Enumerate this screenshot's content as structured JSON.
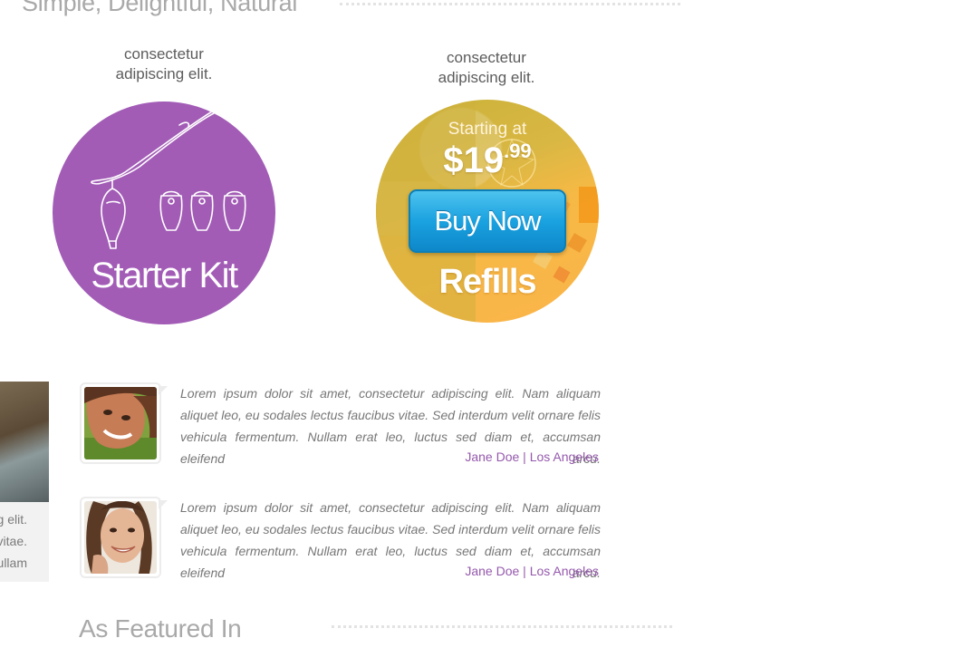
{
  "sections": {
    "top_title": "Simple, Delightful, Natural",
    "featured_title": "As Featured In"
  },
  "products": {
    "starter": {
      "caption_line1": "consectetur",
      "caption_line2": "adipiscing elit.",
      "label": "Starter Kit",
      "color": "#a25cb6"
    },
    "refills": {
      "caption_line1": "consectetur",
      "caption_line2": "adipiscing elit.",
      "starting_text": "Starting at",
      "price_main": "$19",
      "price_cents": ".99",
      "button_label": "Buy Now",
      "label": "Refills",
      "color": "#f6b945"
    }
  },
  "left_card": {
    "lines": [
      "g elit.",
      "vitae.",
      "ullam"
    ]
  },
  "testimonials": [
    {
      "text": "Lorem ipsum dolor sit amet, consectetur adipiscing elit. Nam aliquam aliquet leo, eu sodales lectus faucibus vitae. Sed interdum velit ornare felis vehicula fermentum. Nullam erat leo, luctus sed diam et, accumsan eleifend arcu.",
      "author": "Jane Doe | Los Angeles"
    },
    {
      "text": "Lorem ipsum dolor sit amet, consectetur adipiscing elit. Nam aliquam aliquet leo, eu sodales lectus faucibus vitae. Sed interdum velit ornare felis vehicula fermentum. Nullam erat leo, luctus sed diam et, accumsan eleifend arcu.",
      "author": "Jane Doe | Los Angeles"
    }
  ],
  "colors": {
    "accent_purple": "#9559ad",
    "button_blue": "#1aa2e0"
  }
}
